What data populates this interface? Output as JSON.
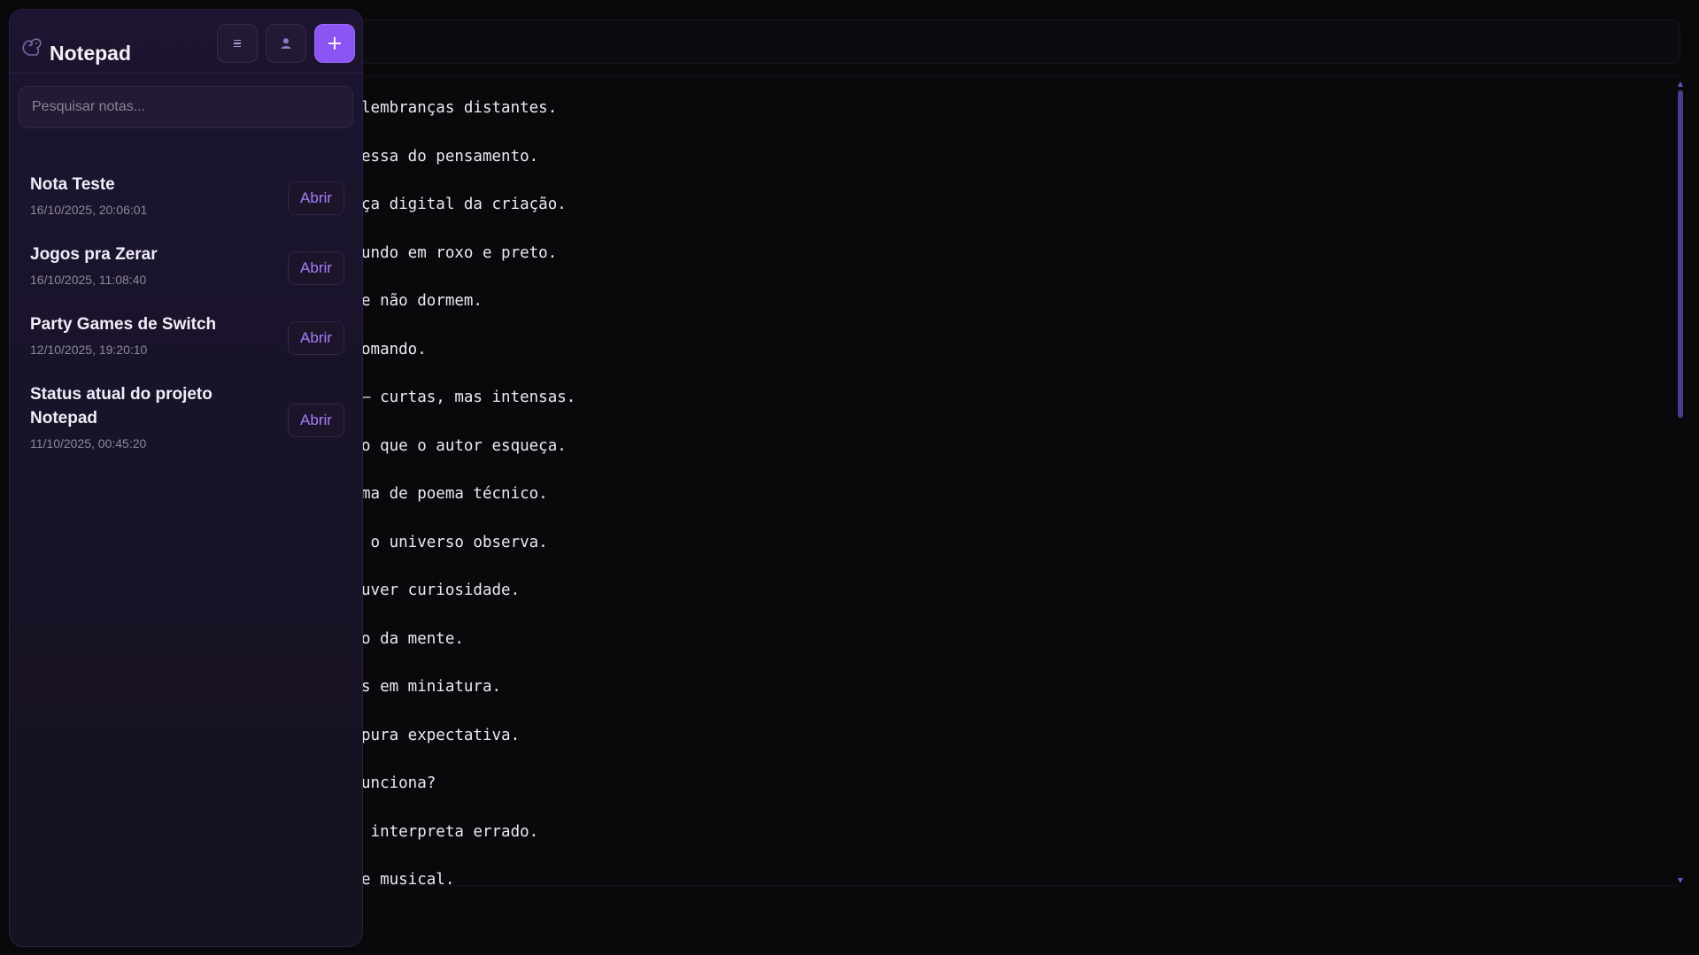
{
  "app": {
    "title": "Notepad"
  },
  "header": {
    "menu_icon": "menu-icon",
    "user_icon": "user-icon",
    "add_label": "+"
  },
  "search": {
    "placeholder": "Pesquisar notas...",
    "value": ""
  },
  "notes": [
    {
      "title": "Nota Teste",
      "date": "16/10/2025, 20:06:01",
      "action": "Abrir"
    },
    {
      "title": "Jogos pra Zerar",
      "date": "16/10/2025, 11:08:40",
      "action": "Abrir"
    },
    {
      "title": "Party Games de Switch",
      "date": "12/10/2025, 19:20:10",
      "action": "Abrir"
    },
    {
      "title": "Status atual do projeto Notepad",
      "date": "11/10/2025, 00:45:20",
      "action": "Abrir"
    }
  ],
  "editor": {
    "visible_lines": [
      "lembranças distantes.",
      "essa do pensamento.",
      "ça digital da criação.",
      "undo em roxo e preto.",
      "e não dormem.",
      "omando.",
      "— curtas, mas intensas.",
      "o que o autor esqueça.",
      "ma de poema técnico.",
      " o universo observa.",
      "uver curiosidade.",
      "o da mente.",
      "s em miniatura.",
      "pura expectativa.",
      "unciona?",
      " interpreta errado.",
      "e musical."
    ]
  },
  "colors": {
    "accent": "#8a55f2",
    "accent_text": "#a77dfb",
    "background": "#09080b",
    "sidebar": "#1a132b"
  }
}
